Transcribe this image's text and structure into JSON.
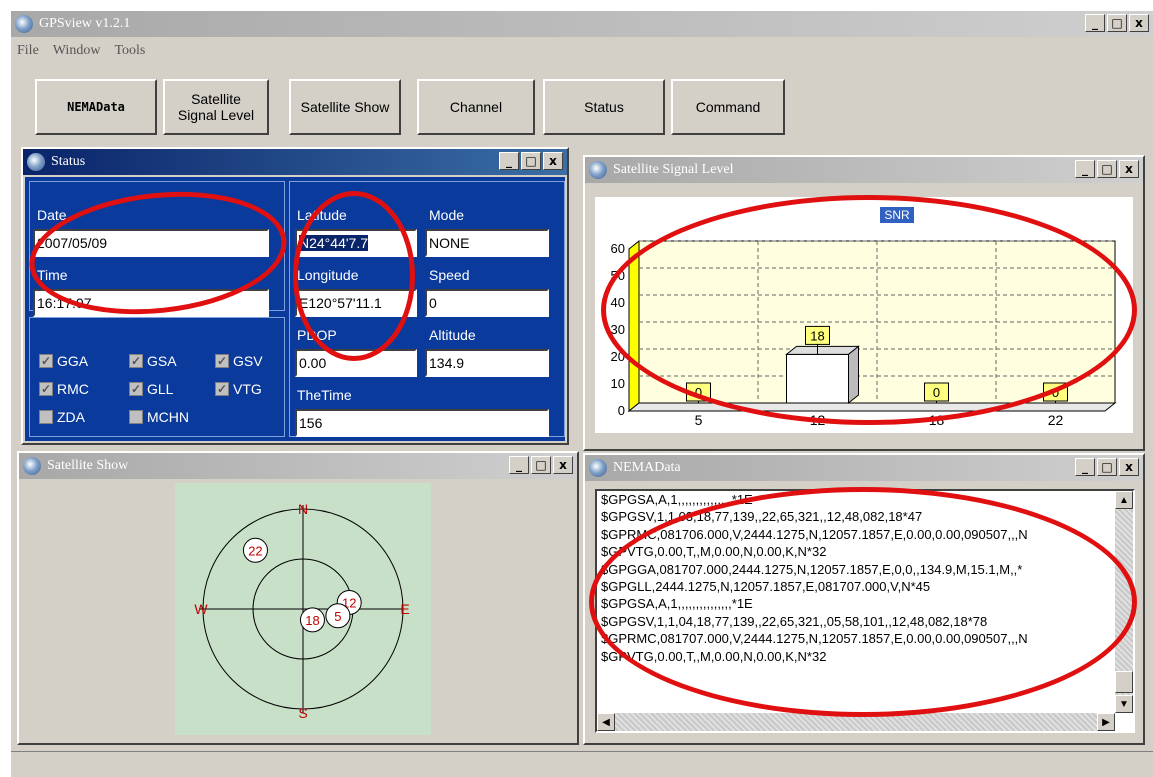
{
  "app": {
    "title": "GPSview v1.2.1"
  },
  "menu": [
    "File",
    "Window",
    "Tools"
  ],
  "toolbar": [
    {
      "label": "NEMAData"
    },
    {
      "label": "Satellite Signal Level"
    },
    {
      "label": "Satellite Show"
    },
    {
      "label": "Channel"
    },
    {
      "label": "Status"
    },
    {
      "label": "Command"
    }
  ],
  "window_controls": {
    "minimize": "_",
    "maximize": "□",
    "close": "x"
  },
  "status_window": {
    "title": "Status",
    "date_label": "Date",
    "date_value": "2007/05/09",
    "time_label": "Time",
    "time_value": "16:17:07",
    "latitude_label": "Latitude",
    "latitude_value": "N24°44'7.7",
    "longitude_label": "Longitude",
    "longitude_value": "E120°57'11.1",
    "mode_label": "Mode",
    "mode_value": "NONE",
    "speed_label": "Speed",
    "speed_value": "0",
    "pdop_label": "PDOP",
    "pdop_value": "0.00",
    "altitude_label": "Altitude",
    "altitude_value": "134.9",
    "thetime_label": "TheTime",
    "thetime_value": "156",
    "checkboxes": [
      {
        "label": "GGA",
        "checked": true
      },
      {
        "label": "GSA",
        "checked": true
      },
      {
        "label": "GSV",
        "checked": true
      },
      {
        "label": "RMC",
        "checked": true
      },
      {
        "label": "GLL",
        "checked": true
      },
      {
        "label": "VTG",
        "checked": true
      },
      {
        "label": "ZDA",
        "checked": false
      },
      {
        "label": "MCHN",
        "checked": false
      }
    ]
  },
  "signal_window": {
    "title": "Satellite Signal Level"
  },
  "chart_data": {
    "type": "bar",
    "title": "SNR",
    "categories": [
      "5",
      "12",
      "18",
      "22"
    ],
    "values": [
      0,
      18,
      0,
      0
    ],
    "yticks": [
      0,
      10,
      20,
      30,
      40,
      50,
      60
    ],
    "ylim": [
      0,
      60
    ],
    "grid": true
  },
  "satellite_show": {
    "title": "Satellite Show",
    "directions": {
      "n": "N",
      "s": "S",
      "e": "E",
      "w": "W"
    },
    "satellites": [
      {
        "prn": "22",
        "azimuth": 321,
        "elevation": 22
      },
      {
        "prn": "12",
        "azimuth": 82,
        "elevation": 48
      },
      {
        "prn": "5",
        "azimuth": 101,
        "elevation": 58
      },
      {
        "prn": "18",
        "azimuth": 139,
        "elevation": 77
      }
    ]
  },
  "nema_window": {
    "title": "NEMAData",
    "lines": [
      "$GPGSA,A,1,,,,,,,,,,,,,,,*1E",
      "$GPGSV,1,1,03,18,77,139,,22,65,321,,12,48,082,18*47",
      "$GPRMC,081706.000,V,2444.1275,N,12057.1857,E,0.00,0.00,090507,,,N",
      "$GPVTG,0.00,T,,M,0.00,N,0.00,K,N*32",
      "$GPGGA,081707.000,2444.1275,N,12057.1857,E,0,0,,134.9,M,15.1,M,,*",
      "$GPGLL,2444.1275,N,12057.1857,E,081707.000,V,N*45",
      "$GPGSA,A,1,,,,,,,,,,,,,,,*1E",
      "$GPGSV,1,1,04,18,77,139,,22,65,321,,05,58,101,,12,48,082,18*78",
      "$GPRMC,081707.000,V,2444.1275,N,12057.1857,E,0.00,0.00,090507,,,N",
      "$GPVTG,0.00,T,,M,0.00,N,0.00,K,N*32"
    ]
  },
  "colors": {
    "annotation": "#e01010",
    "status_bg": "#0a3a9c",
    "chart_bg": "#ffffe0"
  }
}
